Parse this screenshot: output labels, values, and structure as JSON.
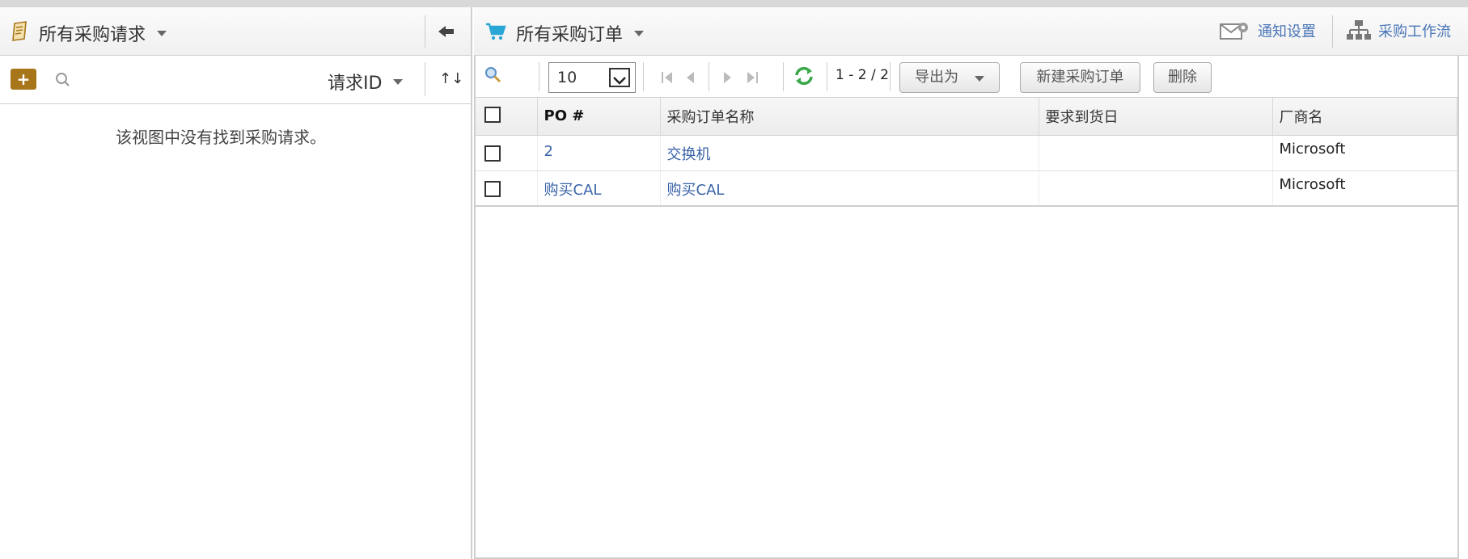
{
  "left": {
    "title": "所有采购请求",
    "add_label": "+",
    "sort_field": "请求ID",
    "sort_order": "↑↓",
    "empty_message": "该视图中没有找到采购请求。"
  },
  "right": {
    "title": "所有采购订单",
    "notify_label": "通知设置",
    "workflow_label": "采购工作流",
    "toolbar": {
      "page_size": "10",
      "page_info": "1 - 2 / 2",
      "export_label": "导出为",
      "new_order_label": "新建采购订单",
      "delete_label": "删除"
    },
    "columns": [
      "PO #",
      "采购订单名称",
      "要求到货日",
      "厂商名"
    ],
    "rows": [
      {
        "po": "2",
        "name": "交换机",
        "date": "",
        "vendor": "Microsoft"
      },
      {
        "po": "购买CAL",
        "name": "购买CAL",
        "date": "",
        "vendor": "Microsoft"
      }
    ]
  },
  "colors": {
    "accent_link": "#3a63a8",
    "add_button": "#a8761a",
    "cart_icon": "#2aa6d6",
    "refresh_icon": "#3aa84a"
  },
  "icons": [
    "request-icon",
    "back-arrow-icon",
    "search-icon",
    "cart-icon",
    "notify-settings-icon",
    "workflow-icon",
    "filter-icon",
    "first-page-icon",
    "prev-page-icon",
    "next-page-icon",
    "last-page-icon",
    "refresh-icon"
  ]
}
